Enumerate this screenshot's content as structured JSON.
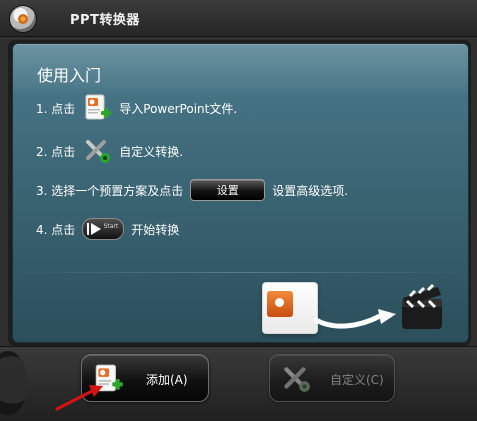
{
  "window": {
    "title": "PPT转换器"
  },
  "panel": {
    "title": "使用入门",
    "steps": [
      {
        "prefix": "1. 点击",
        "text": "导入PowerPoint文件."
      },
      {
        "prefix": "2. 点击",
        "text": "自定义转换."
      },
      {
        "prefix": "3. 选择一个预置方案及点击",
        "button": "设置",
        "text": "设置高级选项."
      },
      {
        "prefix": "4. 点击",
        "button_text": "Start",
        "text": "开始转换"
      }
    ]
  },
  "buttons": {
    "add_label": "添加(A)",
    "customize_label": "自定义(C)"
  },
  "icons": {
    "app_logo": "app-logo-icon",
    "add_file": "add-file-icon",
    "customize_tools": "tools-icon",
    "start": "start-icon",
    "ppt_document": "powerpoint-document-icon",
    "convert_arrow": "convert-arrow-icon",
    "movie_clapper": "movie-clapper-icon",
    "red_pointer": "red-arrow-icon"
  },
  "colors": {
    "panel_gradient_top": "#4c7c8d",
    "panel_gradient_bottom": "#2b4f5b",
    "dark_chrome": "#2f2f2f"
  }
}
